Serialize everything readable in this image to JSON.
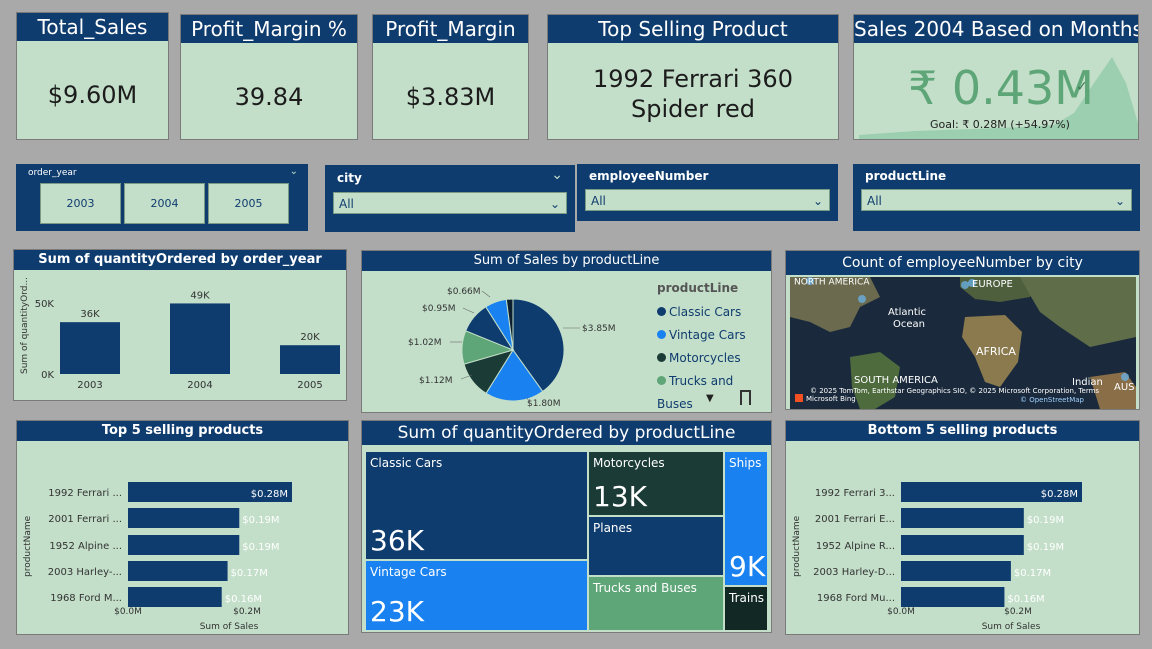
{
  "kpis": {
    "total_sales": {
      "title": "Total_Sales",
      "value": "$9.60M"
    },
    "profit_margin_pct": {
      "title": "Profit_Margin %",
      "value": "39.84"
    },
    "profit_margin": {
      "title": "Profit_Margin",
      "value": "$3.83M"
    },
    "top_product": {
      "title": "Top Selling Product",
      "value_line1": "1992 Ferrari 360",
      "value_line2": "Spider red"
    },
    "sales_2004": {
      "title": "Sales 2004 Based on Months",
      "value": "₹ 0.43M",
      "goal": "Goal: ₹ 0.28M (+54.97%)"
    }
  },
  "slicers": {
    "order_year": {
      "label": "order_year",
      "options": [
        "2003",
        "2004",
        "2005"
      ]
    },
    "city": {
      "label": "city",
      "value": "All"
    },
    "employee": {
      "label": "employeeNumber",
      "value": "All"
    },
    "productline": {
      "label": "productLine",
      "value": "All"
    }
  },
  "qty_by_year": {
    "title": "Sum of quantityOrdered by order_year",
    "ylabel": "Sum of quantityOrd...",
    "yticks": [
      "50K",
      "0K"
    ]
  },
  "pie": {
    "title": "Sum of Sales by productLine",
    "legend_title": "productLine",
    "labels": [
      "$3.85M",
      "$1.80M",
      "$1.12M",
      "$1.02M",
      "$0.95M",
      "$0.66M"
    ]
  },
  "map": {
    "title": "Count of employeeNumber by city",
    "places": [
      "NORTH AMERICA",
      "EUROPE",
      "Atlantic",
      "Ocean",
      "AFRICA",
      "SOUTH AMERICA",
      "Indian",
      "AUS"
    ],
    "attribution": "© 2025 TomTom, Earthstar Geographics SIO, © 2025 Microsoft Corporation, Terms",
    "osm": "© OpenStreetMap",
    "bing": "Microsoft Bing"
  },
  "top5": {
    "title": "Top 5 selling products",
    "ylabel": "productName",
    "xlabel": "Sum of Sales",
    "xticks": [
      "$0.0M",
      "$0.2M"
    ],
    "cats": [
      "1992 Ferrari ...",
      "2001 Ferrari ...",
      "1952 Alpine ...",
      "2003 Harley-...",
      "1968 Ford M..."
    ],
    "labels": [
      "$0.28M",
      "$0.19M",
      "$0.19M",
      "$0.17M",
      "$0.16M"
    ]
  },
  "treemap": {
    "title": "Sum of quantityOrdered by productLine",
    "cells": [
      {
        "label": "Classic Cars",
        "value": "36K"
      },
      {
        "label": "Vintage Cars",
        "value": "23K"
      },
      {
        "label": "Motorcycles",
        "value": "13K"
      },
      {
        "label": "Planes",
        "value": ""
      },
      {
        "label": "Trucks and Buses",
        "value": ""
      },
      {
        "label": "Ships",
        "value": "9K"
      },
      {
        "label": "Trains",
        "value": ""
      }
    ]
  },
  "bottom5": {
    "title": "Bottom 5 selling products",
    "ylabel": "productName",
    "xlabel": "Sum of Sales",
    "xticks": [
      "$0.0M",
      "$0.2M"
    ],
    "cats": [
      "1992 Ferrari 3...",
      "2001 Ferrari E...",
      "1952 Alpine R...",
      "2003 Harley-D...",
      "1968 Ford Mu..."
    ],
    "labels": [
      "$0.28M",
      "$0.19M",
      "$0.19M",
      "$0.17M",
      "$0.16M"
    ]
  },
  "colors": {
    "navy": "#0f3c6e",
    "panel": "#c3dfc9",
    "blue": "#1a82f0",
    "darkgreen": "#1b3b36",
    "green": "#5ea577"
  },
  "chart_data": [
    {
      "type": "bar",
      "title": "Sum of quantityOrdered by order_year",
      "xlabel": "",
      "ylabel": "Sum of quantityOrd...",
      "categories": [
        "2003",
        "2004",
        "2005"
      ],
      "values": [
        36000,
        49000,
        20000
      ],
      "data_labels": [
        "36K",
        "49K",
        "20K"
      ],
      "ylim": [
        0,
        60000
      ]
    },
    {
      "type": "pie",
      "title": "Sum of Sales by productLine",
      "categories": [
        "Classic Cars",
        "Vintage Cars",
        "Motorcycles",
        "Trucks and Buses",
        "Planes",
        "Ships",
        "Trains"
      ],
      "values": [
        3.85,
        1.8,
        1.12,
        1.02,
        0.95,
        0.66,
        0.2
      ]
    },
    {
      "type": "bar",
      "title": "Top 5 selling products",
      "xlabel": "Sum of Sales",
      "ylabel": "productName",
      "categories": [
        "1992 Ferrari ...",
        "2001 Ferrari ...",
        "1952 Alpine ...",
        "2003 Harley-...",
        "1968 Ford M..."
      ],
      "values": [
        0.28,
        0.19,
        0.19,
        0.17,
        0.16
      ],
      "xlim": [
        0,
        0.3
      ]
    },
    {
      "type": "bar",
      "title": "Bottom 5 selling products",
      "xlabel": "Sum of Sales",
      "ylabel": "productName",
      "categories": [
        "1992 Ferrari 3...",
        "2001 Ferrari E...",
        "1952 Alpine R...",
        "2003 Harley-D...",
        "1968 Ford Mu..."
      ],
      "values": [
        0.28,
        0.19,
        0.19,
        0.17,
        0.16
      ],
      "xlim": [
        0,
        0.3
      ]
    },
    {
      "type": "table",
      "title": "Sum of quantityOrdered by productLine",
      "categories": [
        "Classic Cars",
        "Vintage Cars",
        "Motorcycles",
        "Planes",
        "Trucks and Buses",
        "Ships",
        "Trains"
      ],
      "values": [
        36000,
        23000,
        13000,
        11000,
        11000,
        9000,
        3000
      ]
    }
  ]
}
